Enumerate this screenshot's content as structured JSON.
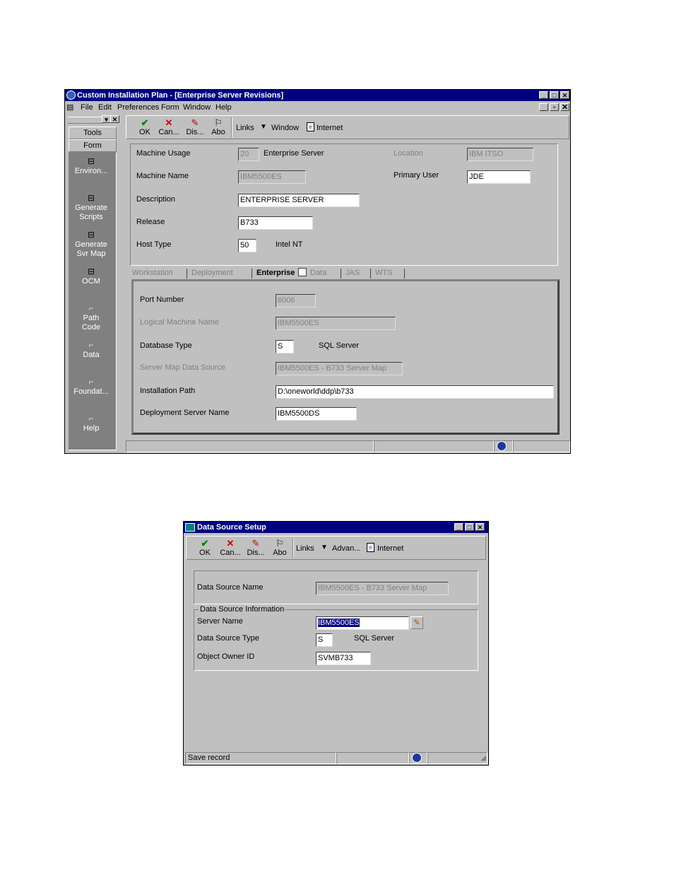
{
  "win1": {
    "title": "Custom Installation Plan - [Enterprise Server Revisions]",
    "menu": [
      "File",
      "Edit",
      "Preferences",
      "Form",
      "Window",
      "Help"
    ],
    "toolbar": {
      "ok": "OK",
      "cancel": "Can...",
      "display": "Dis...",
      "about": "Abo",
      "links": "Links",
      "window": "Window",
      "internet": "Internet"
    },
    "sidebar": {
      "tools": "Tools",
      "form": "Form",
      "items": [
        {
          "label": "Environ..."
        },
        {
          "label": "Generate Scripts"
        },
        {
          "label": "Generate Svr Map"
        },
        {
          "label": "OCM"
        },
        {
          "label": "Path Code"
        },
        {
          "label": "Data"
        },
        {
          "label": "Foundat..."
        },
        {
          "label": "Help"
        }
      ]
    },
    "header": {
      "machine_usage_label": "Machine Usage",
      "machine_usage_value": "20",
      "machine_usage_desc": "Enterprise Server",
      "location_label": "Location",
      "location_value": "IBM ITSO",
      "machine_name_label": "Machine Name",
      "machine_name_value": "IBM5500ES",
      "primary_user_label": "Primary User",
      "primary_user_value": "JDE",
      "description_label": "Description",
      "description_value": "ENTERPRISE SERVER",
      "release_label": "Release",
      "release_value": "B733",
      "host_type_label": "Host Type",
      "host_type_value": "50",
      "host_type_desc": "Intel NT"
    },
    "tabs": [
      "Workstation",
      "Deployment",
      "Enterprise",
      "Data",
      "JAS",
      "WTS"
    ],
    "enterprise": {
      "port_number_label": "Port Number",
      "port_number_value": "6006",
      "logical_machine_label": "Logical Machine Name",
      "logical_machine_value": "IBM5500ES",
      "db_type_label": "Database Type",
      "db_type_value": "S",
      "db_type_desc": "SQL Server",
      "svr_map_label": "Server Map Data Source",
      "svr_map_value": "IBM5500ES - B733 Server Map",
      "install_path_label": "Installation Path",
      "install_path_value": "D:\\oneworld\\ddp\\b733",
      "deploy_server_label": "Deployment Server Name",
      "deploy_server_value": "IBM5500DS"
    }
  },
  "win2": {
    "title": "Data Source Setup",
    "toolbar": {
      "ok": "OK",
      "cancel": "Can...",
      "display": "Dis...",
      "about": "Abo",
      "links": "Links",
      "advanced": "Advan...",
      "internet": "Internet"
    },
    "ds_name_label": "Data Source Name",
    "ds_name_value": "IBM5500ES - B733 Server Map",
    "group_title": "Data Source Information",
    "server_name_label": "Server Name",
    "server_name_value": "IBM5500ES",
    "ds_type_label": "Data Source Type",
    "ds_type_value": "S",
    "ds_type_desc": "SQL Server",
    "owner_label": "Object Owner ID",
    "owner_value": "SVMB733",
    "status": "Save record"
  }
}
